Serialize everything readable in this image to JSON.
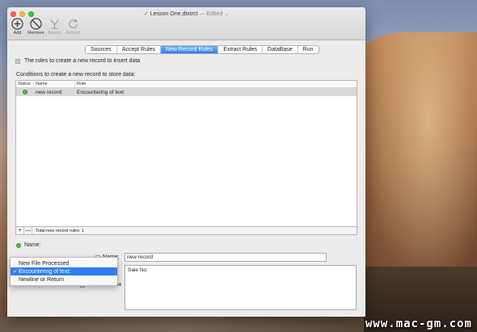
{
  "window": {
    "title_check": "✓",
    "title": "Lesson One.dtxtrct",
    "title_status": "— Edited ⌄"
  },
  "toolbar": {
    "add": "Add",
    "remove": "Remove",
    "export": "Export",
    "extract": "Extract"
  },
  "tabs": [
    {
      "label": "Sources",
      "active": false
    },
    {
      "label": "Accept Rules",
      "active": false
    },
    {
      "label": "New Record Rules",
      "active": true
    },
    {
      "label": "Extract Rules",
      "active": false
    },
    {
      "label": "DataBase",
      "active": false
    },
    {
      "label": "Run",
      "active": false
    }
  ],
  "rules_description": "The rules to create a new record to insert data",
  "conditions_label": "Conditions to create a new record to store data:",
  "table": {
    "columns": [
      "Status",
      "Name",
      "Rule"
    ],
    "rows": [
      {
        "name": "new record",
        "rule": "Encountering of text:"
      }
    ],
    "footer_add": "+",
    "footer_remove": "—",
    "footer_total": "Total new record rules: 1"
  },
  "detail": {
    "name_label": "Name:",
    "name_field_label": "Name:",
    "name_value": "new record",
    "text_value": "Sale No.",
    "case_sensitive_label": "Case Sensitive"
  },
  "menu": {
    "items": [
      {
        "label": "New File Processed",
        "checked": false,
        "selected": false
      },
      {
        "label": "Encountering of text:",
        "checked": true,
        "selected": true
      },
      {
        "label": "Newline or Return",
        "checked": false,
        "selected": false
      }
    ],
    "check_mark": "✓"
  },
  "watermark": "www.mac-gm.com",
  "colors": {
    "accent": "#2f7ff0",
    "status_ok": "#5fb24f"
  }
}
